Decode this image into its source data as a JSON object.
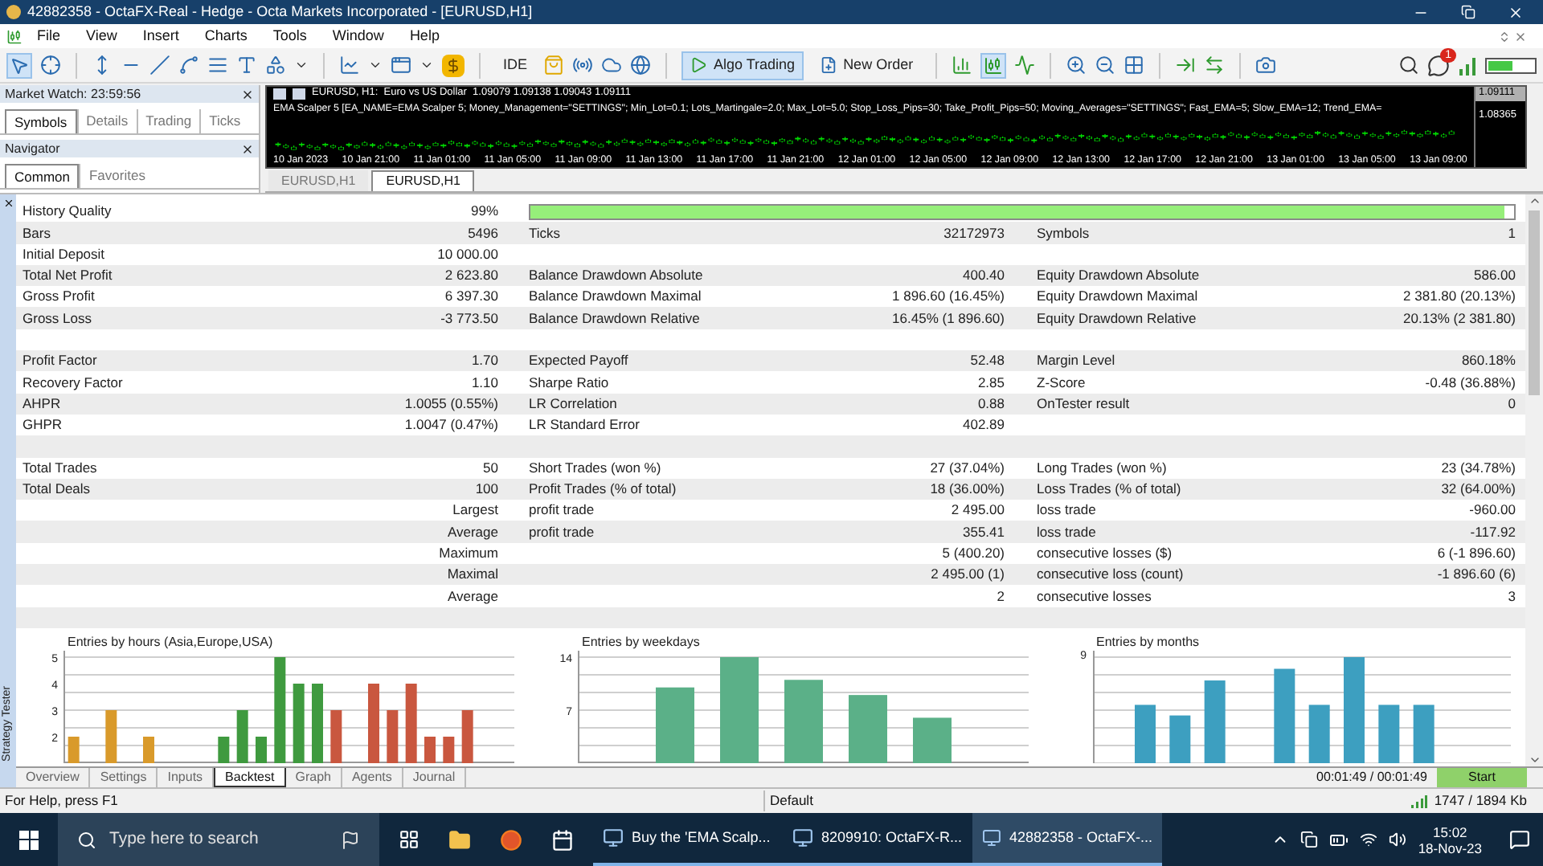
{
  "window": {
    "title": "42882358 - OctaFX-Real - Hedge - Octa Markets Incorporated - [EURUSD,H1]"
  },
  "menu": [
    "File",
    "View",
    "Insert",
    "Charts",
    "Tools",
    "Window",
    "Help"
  ],
  "toolbar": {
    "buttons": [
      {
        "kind": "text",
        "label": "IDE",
        "selected": false
      },
      {
        "kind": "algo",
        "label": "Algo Trading",
        "selected": true
      },
      {
        "kind": "order",
        "label": "New Order",
        "selected": false
      }
    ],
    "notification_count": "1"
  },
  "market_watch": {
    "title": "Market Watch: 23:59:56",
    "tabs": [
      {
        "label": "Symbols",
        "selected": true
      },
      {
        "label": "Details",
        "selected": false
      },
      {
        "label": "Trading",
        "selected": false
      },
      {
        "label": "Ticks",
        "selected": false
      }
    ]
  },
  "navigator": {
    "title": "Navigator",
    "tabs": [
      {
        "label": "Common",
        "selected": true
      },
      {
        "label": "Favorites",
        "selected": false
      }
    ]
  },
  "chart": {
    "header": "EURUSD, H1:  Euro vs US Dollar  1.09079 1.09138 1.09043 1.09111",
    "ea_line": "EMA Scalper 5 [EA_NAME=EMA Scalper 5; Money_Management=\"SETTINGS\"; Min_Lot=0.1; Lots_Martingale=2.0; Max_Lot=5.0; Stop_Loss_Pips=30; Take_Profit_Pips=50; Moving_Averages=\"SETTINGS\"; Fast_EMA=5; Slow_EMA=12; Trend_EMA=",
    "prices": [
      {
        "label": "1.09111",
        "selected": true
      },
      {
        "label": "1.08365",
        "selected": false
      }
    ],
    "time_axis": [
      "10 Jan 2023",
      "10 Jan 21:00",
      "11 Jan 01:00",
      "11 Jan 05:00",
      "11 Jan 09:00",
      "11 Jan 13:00",
      "11 Jan 17:00",
      "11 Jan 21:00",
      "12 Jan 01:00",
      "12 Jan 05:00",
      "12 Jan 09:00",
      "12 Jan 13:00",
      "12 Jan 17:00",
      "12 Jan 21:00",
      "13 Jan 01:00",
      "13 Jan 05:00",
      "13 Jan 09:00"
    ],
    "tabs": [
      {
        "label": "EURUSD,H1",
        "selected": false
      },
      {
        "label": "EURUSD,H1",
        "selected": true
      }
    ]
  },
  "strategy_tester": {
    "title": "Strategy Tester",
    "report": [
      {
        "kind": "quality",
        "label_1": "History Quality",
        "value_1": "99%",
        "level": 0.99
      },
      {
        "kind": "stats",
        "label_1": "Bars",
        "value_1": "5496",
        "label_2": "Ticks",
        "value_2": "32172973",
        "label_3": "Symbols",
        "value_3": "1"
      },
      {
        "kind": "stats",
        "label_1": "Initial Deposit",
        "value_1": "10 000.00"
      },
      {
        "kind": "stats",
        "label_1": "Total Net Profit",
        "value_1": "2 623.80",
        "label_2": "Balance Drawdown Absolute",
        "value_2": "400.40",
        "label_3": "Equity Drawdown Absolute",
        "value_3": "586.00"
      },
      {
        "kind": "stats",
        "label_1": "Gross Profit",
        "value_1": "6 397.30",
        "label_2": "Balance Drawdown Maximal",
        "value_2": "1 896.60 (16.45%)",
        "label_3": "Equity Drawdown Maximal",
        "value_3": "2 381.80 (20.13%)"
      },
      {
        "kind": "stats",
        "label_1": "Gross Loss",
        "value_1": "-3 773.50",
        "label_2": "Balance Drawdown Relative",
        "value_2": "16.45% (1 896.60)",
        "label_3": "Equity Drawdown Relative",
        "value_3": "20.13% (2 381.80)"
      },
      {
        "kind": "blank"
      },
      {
        "kind": "stats",
        "label_1": "Profit Factor",
        "value_1": "1.70",
        "label_2": "Expected Payoff",
        "value_2": "52.48",
        "label_3": "Margin Level",
        "value_3": "860.18%"
      },
      {
        "kind": "stats",
        "label_1": "Recovery Factor",
        "value_1": "1.10",
        "label_2": "Sharpe Ratio",
        "value_2": "2.85",
        "label_3": "Z-Score",
        "value_3": "-0.48 (36.88%)"
      },
      {
        "kind": "stats",
        "label_1": "AHPR",
        "value_1": "1.0055 (0.55%)",
        "label_2": "LR Correlation",
        "value_2": "0.88",
        "label_3": "OnTester result",
        "value_3": "0"
      },
      {
        "kind": "stats",
        "label_1": "GHPR",
        "value_1": "1.0047 (0.47%)",
        "label_2": "LR Standard Error",
        "value_2": "402.89"
      },
      {
        "kind": "blank"
      },
      {
        "kind": "stats",
        "label_1": "Total Trades",
        "value_1": "50",
        "label_2": "Short Trades (won %)",
        "value_2": "27 (37.04%)",
        "label_3": "Long Trades (won %)",
        "value_3": "23 (34.78%)"
      },
      {
        "kind": "stats",
        "label_1": "Total Deals",
        "value_1": "100",
        "label_2": "Profit Trades (% of total)",
        "value_2": "18 (36.00%)",
        "label_3": "Loss Trades (% of total)",
        "value_3": "32 (64.00%)"
      },
      {
        "kind": "stats",
        "value_1": "Largest",
        "label_2": "profit trade",
        "value_2": "2 495.00",
        "label_3": "loss trade",
        "value_3": "-960.00"
      },
      {
        "kind": "stats",
        "value_1": "Average",
        "label_2": "profit trade",
        "value_2": "355.41",
        "label_3": "loss trade",
        "value_3": "-117.92"
      },
      {
        "kind": "stats",
        "value_1": "Maximum",
        "value_2": "5 (400.20)",
        "label_3": "consecutive losses ($)",
        "value_3": "6 (-1 896.60)"
      },
      {
        "kind": "stats",
        "value_1": "Maximal",
        "value_2": "2 495.00 (1)",
        "label_3": "consecutive loss (count)",
        "value_3": "-1 896.60 (6)"
      },
      {
        "kind": "stats",
        "value_1": "Average",
        "value_2": "2",
        "label_3": "consecutive losses",
        "value_3": "3"
      },
      {
        "kind": "blank"
      }
    ],
    "charts": [
      {
        "chart_data": {
          "type": "bar",
          "title": "Entries by hours (Asia,Europe,USA)",
          "ylim": [
            1,
            5
          ],
          "yticks": [
            2,
            3,
            4,
            5
          ],
          "series": [
            {
              "color": "#d99a2b",
              "values": [
                2,
                null,
                3,
                null,
                2,
                null,
                null,
                null,
                null,
                null,
                null,
                null,
                null,
                null,
                null,
                null,
                null,
                null,
                null,
                null,
                null,
                null,
                null,
                null
              ]
            },
            {
              "color": "#3f9a3f",
              "values": [
                null,
                null,
                null,
                null,
                null,
                null,
                null,
                null,
                2,
                3,
                2,
                5,
                4,
                4,
                null,
                null,
                null,
                null,
                null,
                null,
                null,
                null,
                null,
                null
              ]
            },
            {
              "color": "#c9573f",
              "values": [
                null,
                null,
                null,
                null,
                null,
                null,
                null,
                null,
                null,
                null,
                null,
                null,
                null,
                null,
                3,
                null,
                4,
                3,
                4,
                2,
                2,
                3,
                null,
                null
              ]
            }
          ]
        }
      },
      {
        "chart_data": {
          "type": "bar",
          "title": "Entries by weekdays",
          "ylim": [
            0,
            14
          ],
          "yticks": [
            7,
            14
          ],
          "categories": [
            null,
            null,
            null,
            null,
            null,
            null,
            null
          ],
          "series": [
            {
              "color": "#5bb088",
              "values": [
                null,
                10,
                14,
                11,
                9,
                6,
                null
              ]
            }
          ]
        }
      },
      {
        "title": "Entries by months",
        "axis_label": "9"
      }
    ],
    "tabs": [
      {
        "label": "Overview",
        "selected": false
      },
      {
        "label": "Settings",
        "selected": false
      },
      {
        "label": "Inputs",
        "selected": false
      },
      {
        "label": "Backtest",
        "selected": true
      },
      {
        "label": "Graph",
        "selected": false
      },
      {
        "label": "Agents",
        "selected": false
      },
      {
        "label": "Journal",
        "selected": false
      }
    ],
    "timer": "00:01:49 / 00:01:49",
    "start_button": "Start"
  },
  "status_bar": {
    "help": "For Help, press F1",
    "profile": "Default",
    "memory": "1747 / 1894 Kb"
  },
  "taskbar": {
    "search_placeholder": "Type here to search",
    "apps": [
      {
        "label": "Buy the 'EMA Scalp...",
        "selected": false
      },
      {
        "label": "8209910: OctaFX-R...",
        "selected": false
      },
      {
        "label": "42882358 - OctaFX-...",
        "selected": true
      }
    ],
    "time": "15:02",
    "date": "18-Nov-23"
  }
}
